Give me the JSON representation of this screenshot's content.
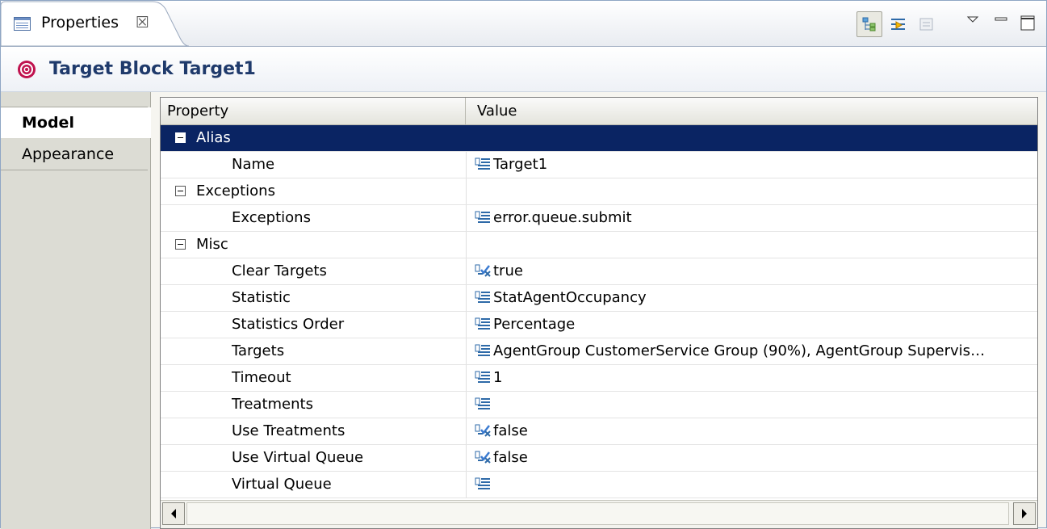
{
  "view_tab": {
    "label": "Properties",
    "close_glyph": "☒",
    "icon": "properties-table-icon"
  },
  "toolbar": {
    "buttons": [
      {
        "icon": "show-categories-icon",
        "pressed": true
      },
      {
        "icon": "show-advanced-properties-icon",
        "pressed": false
      },
      {
        "icon": "restore-default-value-icon",
        "pressed": false
      },
      {
        "icon": "view-menu-icon",
        "pressed": false
      },
      {
        "icon": "minimize-icon",
        "pressed": false
      },
      {
        "icon": "maximize-icon",
        "pressed": false
      }
    ]
  },
  "header": {
    "title": "Target Block Target1",
    "icon": "target-icon"
  },
  "side_tabs": [
    {
      "label": "Model",
      "active": true
    },
    {
      "label": "Appearance",
      "active": false
    }
  ],
  "table": {
    "columns": [
      "Property",
      "Value"
    ],
    "rows": [
      {
        "type": "category",
        "label": "Alias",
        "selected": true
      },
      {
        "type": "property",
        "label": "Name",
        "value": "Target1",
        "value_icon": "text-value-icon"
      },
      {
        "type": "category",
        "label": "Exceptions",
        "selected": false
      },
      {
        "type": "property",
        "label": "Exceptions",
        "value": "error.queue.submit",
        "value_icon": "text-value-icon"
      },
      {
        "type": "category",
        "label": "Misc",
        "selected": false
      },
      {
        "type": "property",
        "label": "Clear Targets",
        "value": "true",
        "value_icon": "boolean-value-icon"
      },
      {
        "type": "property",
        "label": "Statistic",
        "value": "StatAgentOccupancy",
        "value_icon": "text-value-icon"
      },
      {
        "type": "property",
        "label": "Statistics Order",
        "value": "Percentage",
        "value_icon": "text-value-icon"
      },
      {
        "type": "property",
        "label": "Targets",
        "value": "AgentGroup CustomerService Group (90%), AgentGroup Supervis…",
        "value_icon": "text-value-icon"
      },
      {
        "type": "property",
        "label": "Timeout",
        "value": "1",
        "value_icon": "text-value-icon"
      },
      {
        "type": "property",
        "label": "Treatments",
        "value": "",
        "value_icon": "text-value-icon"
      },
      {
        "type": "property",
        "label": "Use Treatments",
        "value": "false",
        "value_icon": "boolean-value-icon"
      },
      {
        "type": "property",
        "label": "Use Virtual Queue",
        "value": "false",
        "value_icon": "boolean-value-icon"
      },
      {
        "type": "property",
        "label": "Virtual Queue",
        "value": "",
        "value_icon": "text-value-icon"
      }
    ]
  },
  "colors": {
    "selection": "#0a2463",
    "title_text": "#1f3a6b",
    "target_icon": "#c0124e"
  }
}
